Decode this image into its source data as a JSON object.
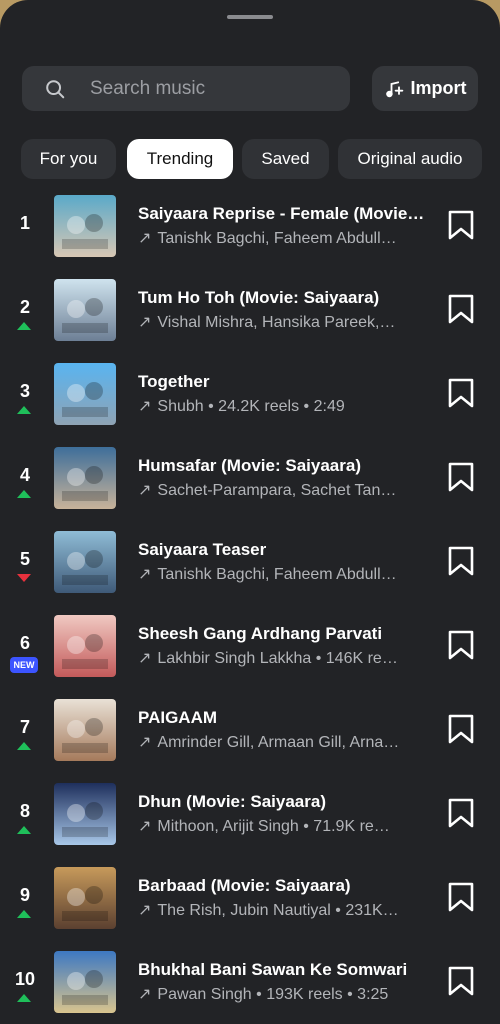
{
  "search": {
    "placeholder": "Search music"
  },
  "import": {
    "label": "Import"
  },
  "tabs": [
    {
      "label": "For you",
      "active": false
    },
    {
      "label": "Trending",
      "active": true
    },
    {
      "label": "Saved",
      "active": false
    },
    {
      "label": "Original audio",
      "active": false
    }
  ],
  "indicator_colors": {
    "up": "#1fbf5a",
    "down": "#e8313d",
    "new": "#3c54ff"
  },
  "tracks": [
    {
      "rank": "1",
      "title": "Saiyaara Reprise - Female (Movie…",
      "subtitle": "Tanishk Bagchi, Faheem Abdull…",
      "trend": "none",
      "art": [
        "#5aa9c9",
        "#d8c7b4"
      ]
    },
    {
      "rank": "2",
      "title": "Tum Ho Toh (Movie: Saiyaara)",
      "subtitle": "Vishal Mishra, Hansika Pareek,…",
      "trend": "up",
      "art": [
        "#cfe3ee",
        "#6d7f95"
      ]
    },
    {
      "rank": "3",
      "title": "Together",
      "subtitle": "Shubh • 24.2K reels • 2:49",
      "trend": "up",
      "art": [
        "#59b4f0",
        "#8fa3b4"
      ]
    },
    {
      "rank": "4",
      "title": "Humsafar (Movie: Saiyaara)",
      "subtitle": "Sachet-Parampara, Sachet Tan…",
      "trend": "up",
      "art": [
        "#3e6e9a",
        "#c8b39a"
      ]
    },
    {
      "rank": "5",
      "title": "Saiyaara Teaser",
      "subtitle": "Tanishk Bagchi, Faheem Abdull…",
      "trend": "down",
      "art": [
        "#8fbcd6",
        "#3f5a78"
      ]
    },
    {
      "rank": "6",
      "title": "Sheesh Gang Ardhang Parvati",
      "subtitle": "Lakhbir Singh Lakkha • 146K re…",
      "trend": "new",
      "new_label": "NEW",
      "art": [
        "#f0c9c2",
        "#c35a5a"
      ]
    },
    {
      "rank": "7",
      "title": "PAIGAAM",
      "subtitle": "Amrinder Gill, Armaan Gill, Arna…",
      "trend": "up",
      "art": [
        "#e9e1d6",
        "#a57a5b"
      ]
    },
    {
      "rank": "8",
      "title": "Dhun (Movie: Saiyaara)",
      "subtitle": "Mithoon, Arijit Singh • 71.9K re…",
      "trend": "up",
      "art": [
        "#1e2f5c",
        "#a8c7e8"
      ]
    },
    {
      "rank": "9",
      "title": "Barbaad (Movie: Saiyaara)",
      "subtitle": "The Rish, Jubin Nautiyal • 231K…",
      "trend": "up",
      "art": [
        "#c79a5b",
        "#5b4030"
      ]
    },
    {
      "rank": "10",
      "title": "Bhukhal Bani Sawan Ke Somwari",
      "subtitle": "Pawan Singh • 193K reels • 3:25",
      "trend": "up",
      "art": [
        "#3d78c2",
        "#d9c48e"
      ]
    }
  ]
}
